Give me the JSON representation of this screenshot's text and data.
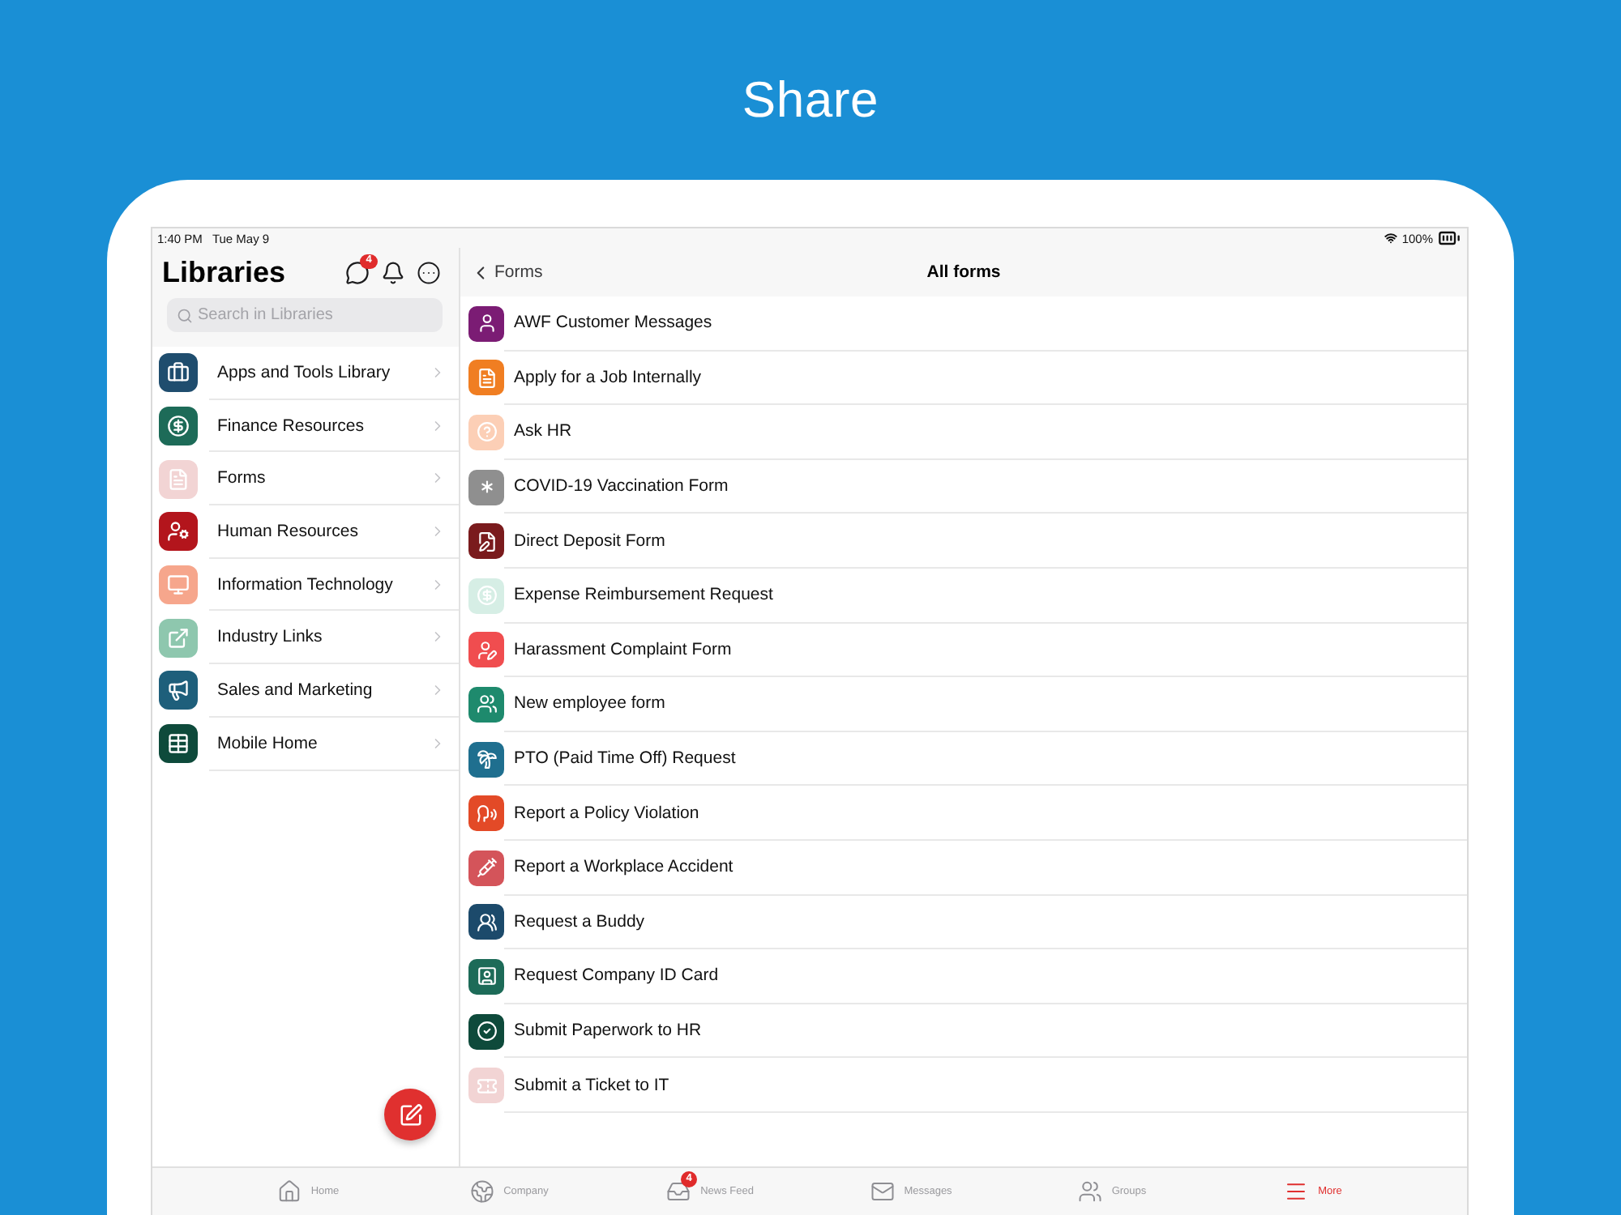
{
  "page": {
    "title": "Share"
  },
  "status_bar": {
    "time": "1:40 PM",
    "date": "Tue May 9",
    "battery": "100%"
  },
  "sidebar": {
    "title": "Libraries",
    "chat_badge": "4",
    "search": {
      "placeholder": "Search in Libraries"
    },
    "items": [
      {
        "label": "Apps and Tools Library",
        "color": "#1f4d6e"
      },
      {
        "label": "Finance Resources",
        "color": "#1d6b58"
      },
      {
        "label": "Forms",
        "color": "#f2d4d4"
      },
      {
        "label": "Human Resources",
        "color": "#b3151c"
      },
      {
        "label": "Information Technology",
        "color": "#f6a68c"
      },
      {
        "label": "Industry Links",
        "color": "#8ec7ae"
      },
      {
        "label": "Sales and Marketing",
        "color": "#1e5f7b"
      },
      {
        "label": "Mobile Home",
        "color": "#0e4a3b"
      }
    ]
  },
  "forms": {
    "back_label": "Forms",
    "title": "All forms",
    "items": [
      {
        "label": "AWF Customer Messages",
        "color": "#7b1c74"
      },
      {
        "label": "Apply for a Job Internally",
        "color": "#f07e22"
      },
      {
        "label": "Ask HR",
        "color": "#fccfb6"
      },
      {
        "label": "COVID-19 Vaccination Form",
        "color": "#8f8f8f"
      },
      {
        "label": "Direct Deposit Form",
        "color": "#7a1b1d"
      },
      {
        "label": "Expense Reimbursement Request",
        "color": "#d6eee5"
      },
      {
        "label": "Harassment Complaint Form",
        "color": "#f04d4f"
      },
      {
        "label": "New employee form",
        "color": "#1e8a6d"
      },
      {
        "label": "PTO (Paid Time Off) Request",
        "color": "#1f6f8f"
      },
      {
        "label": "Report a Policy Violation",
        "color": "#e34a27"
      },
      {
        "label": "Report a Workplace Accident",
        "color": "#d4545a"
      },
      {
        "label": "Request a Buddy",
        "color": "#1c4a6b"
      },
      {
        "label": "Request Company ID Card",
        "color": "#1d6b58"
      },
      {
        "label": "Submit Paperwork to HR",
        "color": "#0e4a3b"
      },
      {
        "label": "Submit a Ticket to IT",
        "color": "#f2d4d4"
      }
    ]
  },
  "tab_bar": {
    "items": [
      {
        "label": "Home",
        "selected": false
      },
      {
        "label": "Company",
        "selected": false
      },
      {
        "label": "News Feed",
        "badge": "4",
        "selected": false
      },
      {
        "label": "Messages",
        "selected": false
      },
      {
        "label": "Groups",
        "selected": false
      },
      {
        "label": "More",
        "selected": true
      }
    ]
  }
}
